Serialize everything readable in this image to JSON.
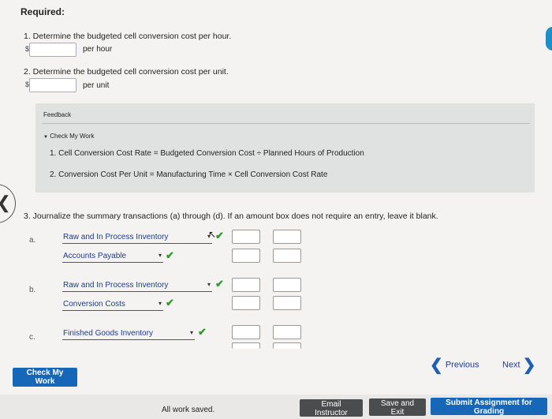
{
  "required": {
    "title": "Required:"
  },
  "q1": {
    "text": "1. Determine the budgeted cell conversion cost per hour.",
    "prefix": "$",
    "unit": "per hour",
    "value": ""
  },
  "q2": {
    "text": "2. Determine the budgeted cell conversion cost per unit.",
    "prefix": "$",
    "unit": "per unit",
    "value": ""
  },
  "feedback": {
    "title": "Feedback",
    "check_label": "Check My Work",
    "lines": [
      "1. Cell Conversion Cost Rate = Budgeted Conversion Cost ÷ Planned Hours of Production",
      "2. Conversion Cost Per Unit = Manufacturing Time × Cell Conversion Cost Rate"
    ]
  },
  "q3": {
    "text": "3. Journalize the summary transactions (a) through (d). If an amount box does not require an entry, leave it blank.",
    "rows": [
      {
        "letter": "a.",
        "account": "Raw and In Process Inventory"
      },
      {
        "letter": "",
        "account": "Accounts Payable"
      },
      {
        "letter": "b.",
        "account": "Raw and In Process Inventory"
      },
      {
        "letter": "",
        "account": "Conversion Costs"
      },
      {
        "letter": "c.",
        "account": "Finished Goods Inventory"
      }
    ]
  },
  "icons": {
    "check": "✔",
    "caret": "▾",
    "prev": "❮",
    "next": "❯"
  },
  "buttons": {
    "check_my_work": "Check My Work",
    "previous": "Previous",
    "next": "Next",
    "email": "Email Instructor",
    "save_exit": "Save and Exit",
    "submit": "Submit Assignment for Grading"
  },
  "status": {
    "saved": "All work saved."
  },
  "colors": {
    "primary": "#1767b9",
    "check": "#2e9a2e",
    "dark_button": "#4a4c4e"
  }
}
